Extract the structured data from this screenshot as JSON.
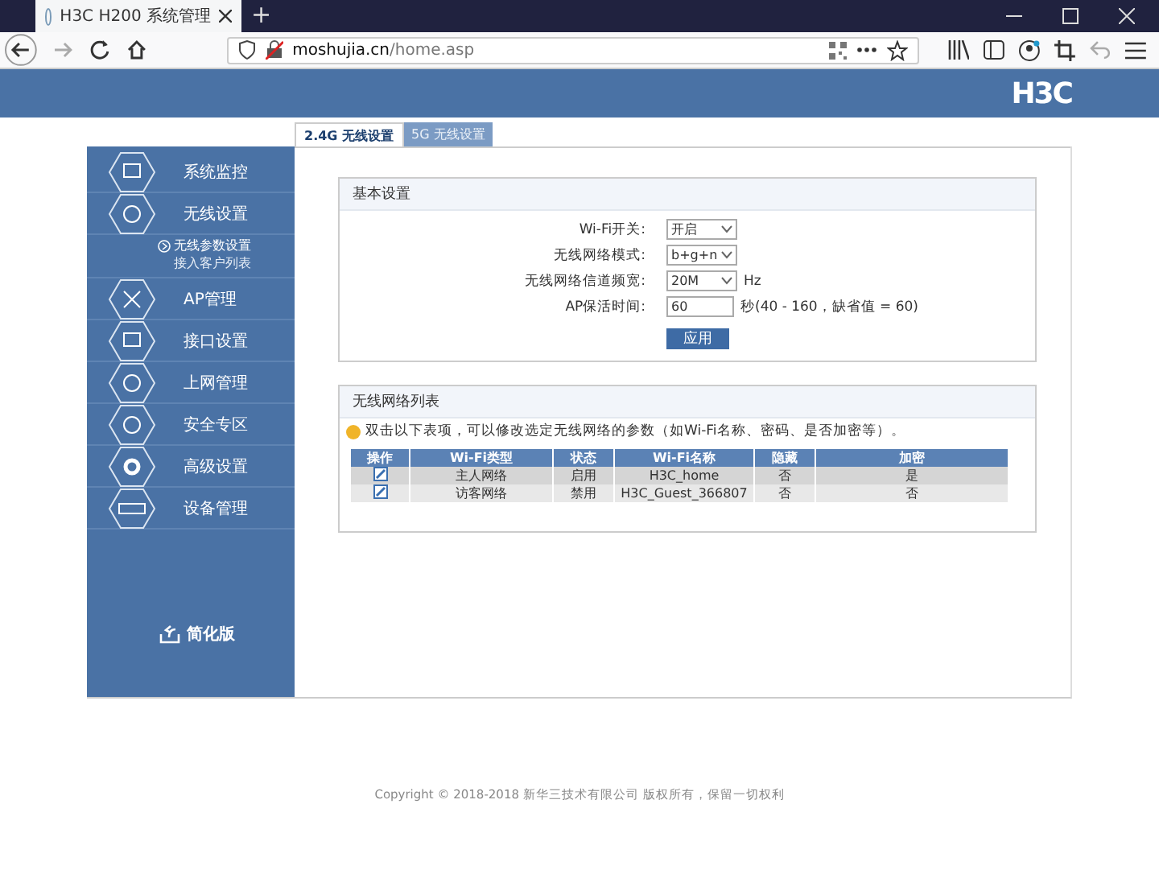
{
  "browser": {
    "tab_title": "H3C H200 系统管理",
    "url_host": "moshujia.cn",
    "url_path": "/home.asp",
    "new_tab": "+"
  },
  "header": {
    "logo": "H3C"
  },
  "tabs": [
    {
      "label": "2.4G 无线设置",
      "selected": true
    },
    {
      "label": "5G 无线设置",
      "selected": false
    }
  ],
  "sidebar": {
    "items": [
      {
        "label": "系统监控"
      },
      {
        "label": "无线设置",
        "children": [
          {
            "label": "无线参数设置",
            "selected": true
          },
          {
            "label": "接入客户列表",
            "selected": false
          }
        ]
      },
      {
        "label": "AP管理"
      },
      {
        "label": "接口设置"
      },
      {
        "label": "上网管理"
      },
      {
        "label": "安全专区"
      },
      {
        "label": "高级设置"
      },
      {
        "label": "设备管理"
      }
    ],
    "simple_version": "简化版"
  },
  "basic": {
    "title": "基本设置",
    "fields": [
      {
        "label": "Wi-Fi开关:",
        "kind": "select",
        "value": "开启"
      },
      {
        "label": "无线网络模式:",
        "kind": "select",
        "value": "b+g+n"
      },
      {
        "label": "无线网络信道频宽:",
        "kind": "select",
        "value": "20M",
        "suffix": "Hz"
      },
      {
        "label": "AP保活时间:",
        "kind": "input",
        "value": "60",
        "suffix": "秒(40 - 160，缺省值 = 60)"
      }
    ],
    "apply": "应用"
  },
  "list": {
    "title": "无线网络列表",
    "hint": "双击以下表项，可以修改选定无线网络的参数（如Wi-Fi名称、密码、是否加密等）。",
    "columns": [
      "操作",
      "Wi-Fi类型",
      "状态",
      "Wi-Fi名称",
      "隐藏",
      "加密"
    ],
    "rows": [
      [
        "",
        "主人网络",
        "启用",
        "H3C_home",
        "否",
        "是"
      ],
      [
        "",
        "访客网络",
        "禁用",
        "H3C_Guest_366807",
        "否",
        "否"
      ]
    ]
  },
  "footer": "Copyright © 2018-2018 新华三技术有限公司 版权所有，保留一切权利"
}
